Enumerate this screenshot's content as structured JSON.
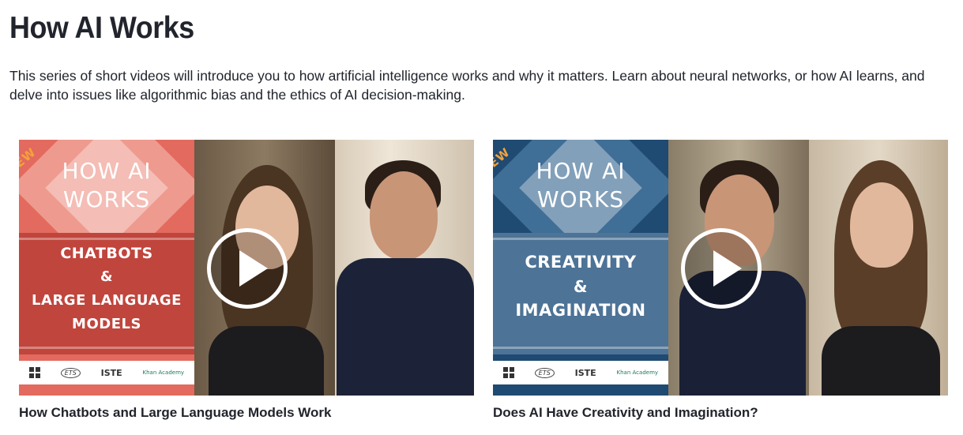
{
  "page": {
    "title": "How AI Works",
    "description": "This series of short videos will introduce you to how artificial intelligence works and why it matters. Learn about neural networks, or how AI learns, and delve into issues like algorithmic bias and the ethics of AI decision-making."
  },
  "videos": [
    {
      "title": "How Chatbots and Large Language Models Work",
      "thumbnail": {
        "ribbon": "NEW",
        "brand_line1": "HOW AI",
        "brand_line2": "WORKS",
        "topic_line1": "CHATBOTS",
        "topic_line2": "&",
        "topic_line3": "LARGE LANGUAGE",
        "topic_line4": "MODELS",
        "logo_ets": "ETS",
        "logo_iste": "ISTE",
        "logo_khan": "Khan Academy",
        "colors": {
          "poster_bg": "#e36a5e",
          "diamond": "#ef9a8e",
          "band": "#c0453d"
        }
      },
      "play_icon": "play-icon"
    },
    {
      "title": "Does AI Have Creativity and Imagination?",
      "thumbnail": {
        "ribbon": "NEW",
        "brand_line1": "HOW AI",
        "brand_line2": "WORKS",
        "topic_line1": "CREATIVITY",
        "topic_line2": "&",
        "topic_line3": "IMAGINATION",
        "logo_ets": "ETS",
        "logo_iste": "ISTE",
        "logo_khan": "Khan Academy",
        "colors": {
          "poster_bg": "#1f4a72",
          "diamond": "#3f6e96",
          "band": "#4d7396"
        }
      },
      "play_icon": "play-icon"
    }
  ]
}
